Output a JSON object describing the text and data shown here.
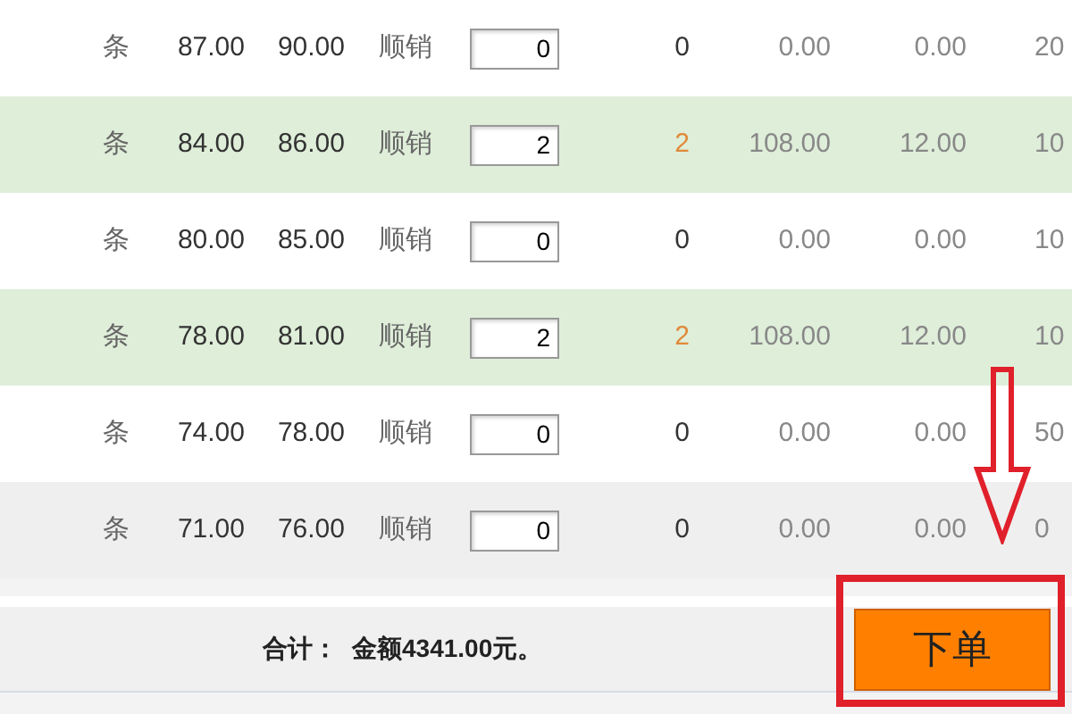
{
  "rows": [
    {
      "unit": "条",
      "price_1": "87.00",
      "price_2": "90.00",
      "mode": "顺销",
      "quantity": "0",
      "count": "0",
      "amount": "0.00",
      "column_8": "0.00",
      "column_9": "20",
      "highlighted": false,
      "color": "#ffffff"
    },
    {
      "unit": "条",
      "price_1": "84.00",
      "price_2": "86.00",
      "mode": "顺销",
      "quantity": "2",
      "count": "2",
      "amount": "108.00",
      "column_8": "12.00",
      "column_9": "10",
      "highlighted": true,
      "color": "#dfeed9"
    },
    {
      "unit": "条",
      "price_1": "80.00",
      "price_2": "85.00",
      "mode": "顺销",
      "quantity": "0",
      "count": "0",
      "amount": "0.00",
      "column_8": "0.00",
      "column_9": "10",
      "highlighted": false,
      "color": "#ffffff"
    },
    {
      "unit": "条",
      "price_1": "78.00",
      "price_2": "81.00",
      "mode": "顺销",
      "quantity": "2",
      "count": "2",
      "amount": "108.00",
      "column_8": "12.00",
      "column_9": "10",
      "highlighted": true,
      "color": "#dfeed9"
    },
    {
      "unit": "条",
      "price_1": "74.00",
      "price_2": "78.00",
      "mode": "顺销",
      "quantity": "0",
      "count": "0",
      "amount": "0.00",
      "column_8": "0.00",
      "column_9": "50",
      "highlighted": false,
      "color": "#ffffff"
    },
    {
      "unit": "条",
      "price_1": "71.00",
      "price_2": "76.00",
      "mode": "顺销",
      "quantity": "0",
      "count": "0",
      "amount": "0.00",
      "column_8": "0.00",
      "column_9": "0",
      "highlighted": false,
      "color": "#efefef"
    }
  ],
  "footer": {
    "total_label": "合计：",
    "total_value": "金额4341.00元。",
    "order_button": "下单"
  },
  "annotation": {
    "arrow": true,
    "highlight_box": true
  }
}
